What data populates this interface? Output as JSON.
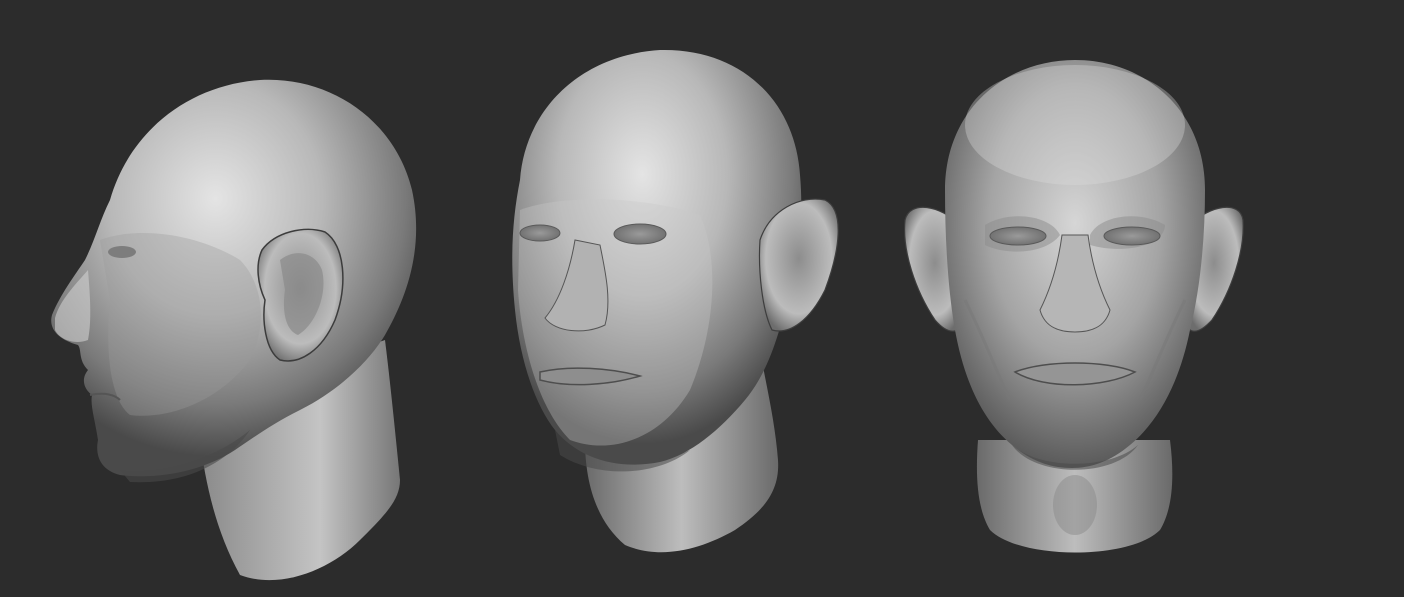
{
  "scene": {
    "background_color": "#2c2c2c",
    "material_color": "#a9a9a9",
    "highlight_color": "#e2e2e2",
    "shadow_color": "#3a3a3a",
    "subjects": [
      {
        "id": "head-side-view",
        "view": "profile-left",
        "icon": "sculpted-head"
      },
      {
        "id": "head-three-quarter-view",
        "view": "three-quarter",
        "icon": "sculpted-head"
      },
      {
        "id": "head-front-view",
        "view": "front",
        "icon": "sculpted-head"
      }
    ]
  }
}
